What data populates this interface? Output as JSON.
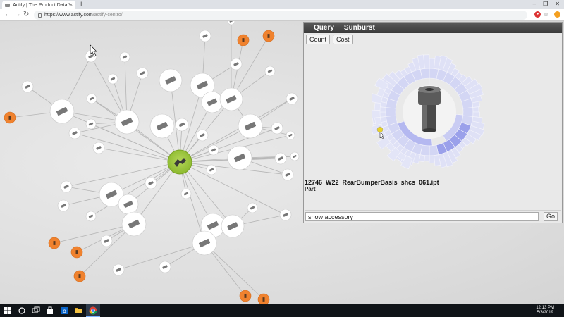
{
  "browser": {
    "tab_title": "Actify | The Product Data V",
    "tab_close": "×",
    "new_tab": "+",
    "url_base": "https://www.actify.com",
    "url_path": "/actify-centro/",
    "win_min": "–",
    "win_max": "❐",
    "win_close": "✕"
  },
  "panel": {
    "tabs": [
      "Query",
      "Sunburst"
    ],
    "buttons": [
      "Count",
      "Cost"
    ],
    "part_name": "12746_W22_RearBumperBasis_shcs_061.ipt",
    "part_type": "Part",
    "command_value": "show accessory",
    "go_label": "Go"
  },
  "graph": {
    "center_color": "#9bc53d",
    "leaf_color": "#f0822e",
    "node_color": "#ffffff"
  },
  "taskbar": {
    "time": "12:13 PM",
    "date": "5/3/2019"
  }
}
